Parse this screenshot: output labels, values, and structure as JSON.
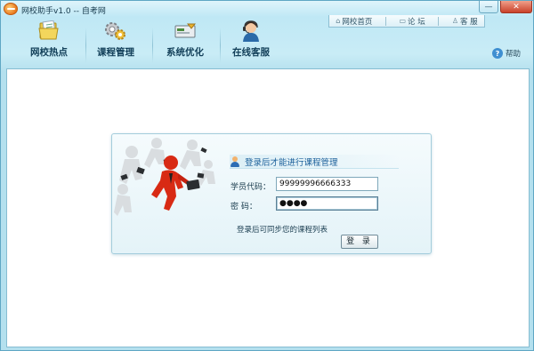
{
  "window": {
    "title": "网校助手v1.0 -- 自考网",
    "controls": {
      "minimize": "—",
      "close": "✕"
    }
  },
  "top_links": [
    {
      "label": "网校首页",
      "icon": "home-icon"
    },
    {
      "label": "论  坛",
      "icon": "forum-icon"
    },
    {
      "label": "客  服",
      "icon": "service-icon"
    }
  ],
  "nav": [
    {
      "label": "网校热点",
      "icon": "folder-icon"
    },
    {
      "label": "课程管理",
      "icon": "gears-icon"
    },
    {
      "label": "系统优化",
      "icon": "optimize-icon"
    },
    {
      "label": "在线客服",
      "icon": "headset-agent-icon"
    }
  ],
  "help": {
    "label": "帮助",
    "icon": "help-icon"
  },
  "login": {
    "title": "登录后才能进行课程管理",
    "student_id_label": "学员代码：",
    "student_id_value": "99999996666333",
    "password_label": "密    码：",
    "password_value": "●●●●",
    "hint": "登录后可同步您的课程列表",
    "submit_label": "登 录"
  },
  "colors": {
    "window_bg": "#bfe6f1",
    "accent": "#1a5f9a",
    "close_button": "#c9412a",
    "figure_red": "#d82a14"
  }
}
